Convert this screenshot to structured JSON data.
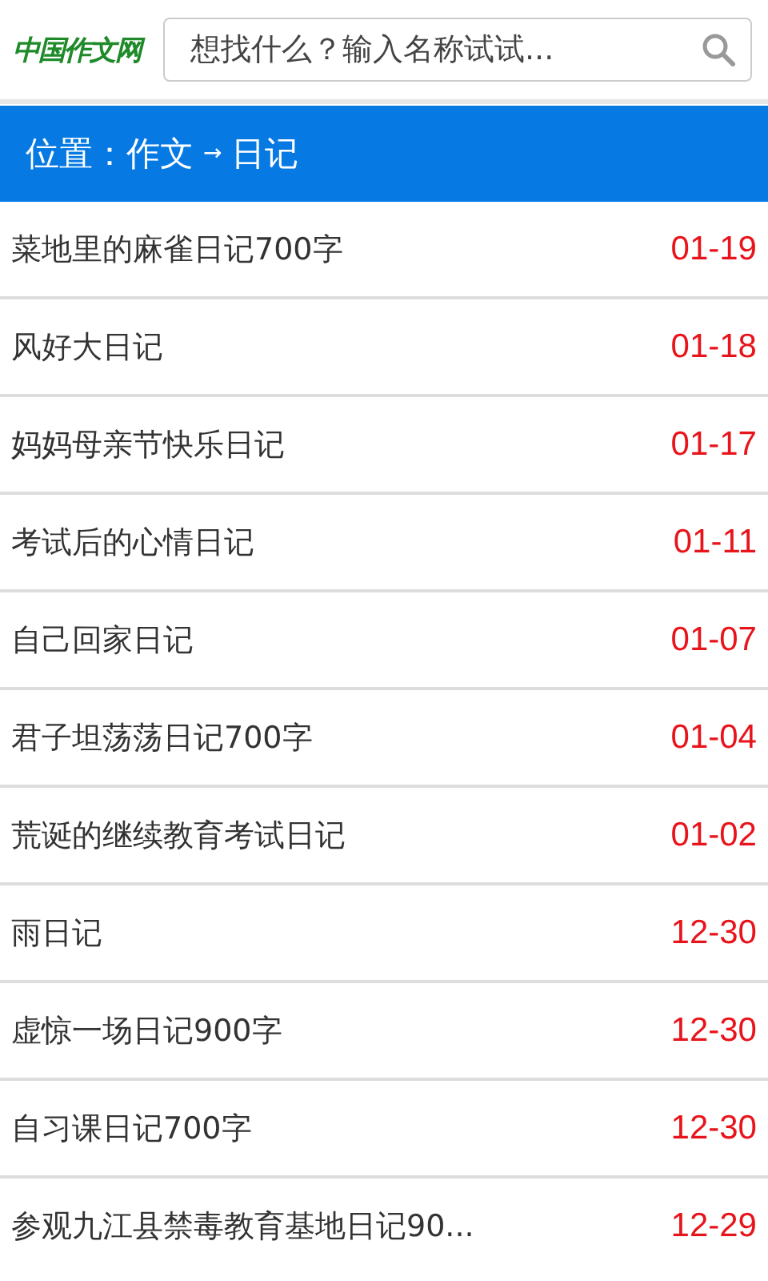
{
  "header": {
    "logo": "中国作文网",
    "search": {
      "placeholder": "想找什么？输入名称试试..."
    }
  },
  "breadcrumb": {
    "label": "位置：",
    "path": [
      "作文",
      "日记"
    ],
    "separator": "→"
  },
  "articles": [
    {
      "title": "菜地里的麻雀日记700字",
      "date": "01-19"
    },
    {
      "title": "风好大日记",
      "date": "01-18"
    },
    {
      "title": "妈妈母亲节快乐日记",
      "date": "01-17"
    },
    {
      "title": "考试后的心情日记",
      "date": "01-11"
    },
    {
      "title": "自己回家日记",
      "date": "01-07"
    },
    {
      "title": "君子坦荡荡日记700字",
      "date": "01-04"
    },
    {
      "title": "荒诞的继续教育考试日记",
      "date": "01-02"
    },
    {
      "title": "雨日记",
      "date": "12-30"
    },
    {
      "title": "虚惊一场日记900字",
      "date": "12-30"
    },
    {
      "title": "自习课日记700字",
      "date": "12-30"
    },
    {
      "title": "参观九江县禁毒教育基地日记90...",
      "date": "12-29"
    }
  ]
}
